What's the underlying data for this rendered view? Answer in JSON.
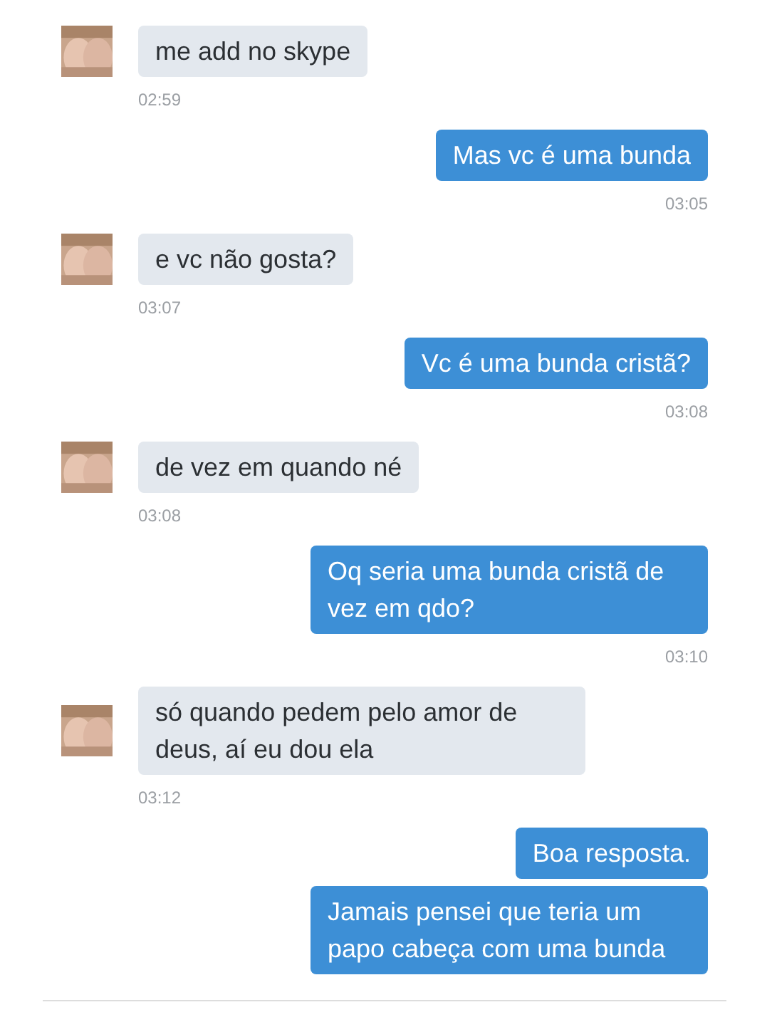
{
  "messages": [
    {
      "kind": "incoming",
      "text": "me add no skype",
      "time": "02:59"
    },
    {
      "kind": "outgoing",
      "text": "Mas vc é uma bunda",
      "time": "03:05"
    },
    {
      "kind": "incoming",
      "text": "e vc não gosta?",
      "time": "03:07"
    },
    {
      "kind": "outgoing",
      "text": "Vc é uma bunda cristã?",
      "time": "03:08"
    },
    {
      "kind": "incoming",
      "text": "de vez em quando né",
      "time": "03:08"
    },
    {
      "kind": "outgoing",
      "text": "Oq seria uma bunda cristã de vez em qdo?",
      "time": "03:10"
    },
    {
      "kind": "incoming",
      "text": "só quando pedem pelo amor de deus, aí eu dou ela",
      "time": "03:12"
    },
    {
      "kind": "outgoing",
      "text": "Boa resposta."
    },
    {
      "kind": "outgoing",
      "text": "Jamais pensei que teria um papo cabeça com uma bunda"
    }
  ]
}
